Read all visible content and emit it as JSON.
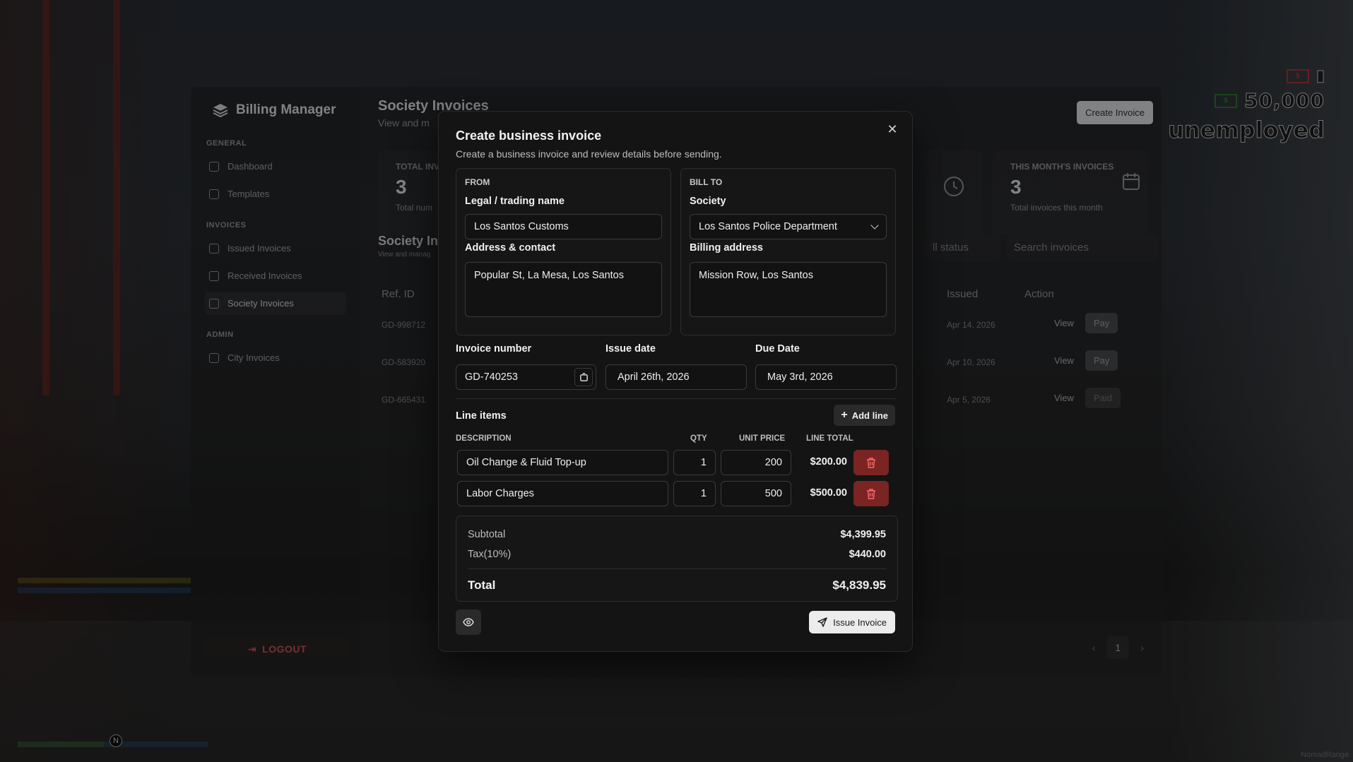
{
  "hud": {
    "cash": "50,000",
    "job": "unemployed",
    "watermark": "NomadRange"
  },
  "app": {
    "brand": "Billing Manager",
    "sidebar": {
      "sections": [
        {
          "title": "GENERAL",
          "items": [
            "Dashboard",
            "Templates"
          ]
        },
        {
          "title": "INVOICES",
          "items": [
            "Issued Invoices",
            "Received Invoices",
            "Society Invoices"
          ]
        },
        {
          "title": "ADMIN",
          "items": [
            "City Invoices"
          ]
        }
      ],
      "logout": "LOGOUT"
    },
    "main": {
      "title": "Society Invoices",
      "subtitle": "View and m",
      "create_button": "Create Invoice",
      "stats": [
        {
          "label": "TOTAL INV",
          "value": "3",
          "foot": "Total num"
        },
        {
          "label": "THIS MONTH'S INVOICES",
          "value": "3",
          "foot": "Total invoices this month"
        }
      ],
      "table_title": "Society Inv",
      "table_sub": "View and manag",
      "status_filter": "ll status",
      "search_placeholder": "Search invoices",
      "columns": {
        "ref": "Ref. ID",
        "issued": "Issued",
        "action": "Action"
      },
      "rows": [
        {
          "ref": "GD-998712",
          "issued": "Apr 14, 2026",
          "view": "View",
          "pay": "Pay"
        },
        {
          "ref": "GD-583920",
          "issued": "Apr 10, 2026",
          "view": "View",
          "pay": "Pay"
        },
        {
          "ref": "GD-665431",
          "issued": "Apr 5, 2026",
          "view": "View",
          "pay": "Paid"
        }
      ],
      "page": "1"
    }
  },
  "modal": {
    "title": "Create business invoice",
    "subtitle": "Create a business invoice and review details before sending.",
    "from": {
      "tag": "FROM",
      "name_label": "Legal / trading name",
      "name_value": "Los Santos Customs",
      "address_label": "Address & contact",
      "address_value": "Popular St, La Mesa, Los Santos"
    },
    "bill_to": {
      "tag": "BILL TO",
      "society_label": "Society",
      "society_value": "Los Santos Police Department",
      "address_label": "Billing address",
      "address_value": "Mission Row, Los Santos"
    },
    "invoice_number_label": "Invoice number",
    "invoice_number": "GD-740253",
    "issue_date_label": "Issue date",
    "issue_date": "April 26th, 2026",
    "due_date_label": "Due Date",
    "due_date": "May 3rd, 2026",
    "line_items_label": "Line items",
    "add_line": "Add line",
    "columns": {
      "description": "DESCRIPTION",
      "qty": "QTY",
      "unit_price": "UNIT PRICE",
      "line_total": "LINE TOTAL"
    },
    "line_items": [
      {
        "description": "Oil Change & Fluid Top-up",
        "qty": "1",
        "unit_price": "200",
        "line_total": "$200.00"
      },
      {
        "description": "Labor Charges",
        "qty": "1",
        "unit_price": "500",
        "line_total": "$500.00"
      }
    ],
    "subtotal_label": "Subtotal",
    "subtotal": "$4,399.95",
    "tax_label": "Tax(10%)",
    "tax": "$440.00",
    "total_label": "Total",
    "total": "$4,839.95",
    "issue_button": "Issue Invoice"
  },
  "colors": {
    "accent_danger": "#7a2424",
    "primary_button": "#ececec",
    "panel": "#141414"
  }
}
